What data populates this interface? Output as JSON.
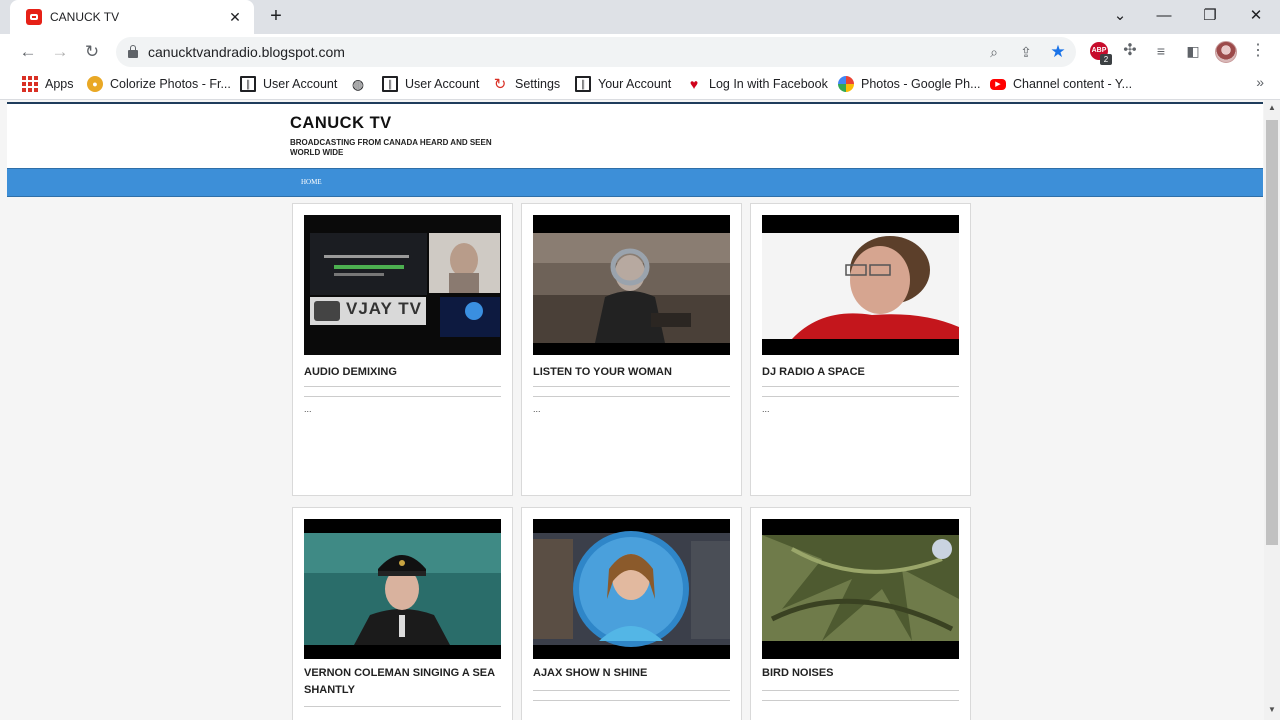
{
  "browser": {
    "tab_title": "CANUCK TV",
    "url": "canucktvandradio.blogspot.com",
    "abp_badge": "2",
    "bookmarks": [
      {
        "label": "Apps",
        "icon": "apps-grid-icon"
      },
      {
        "label": "Colorize Photos - Fr...",
        "icon": "colorize-icon"
      },
      {
        "label": "User Account",
        "icon": "building-icon"
      },
      {
        "label": "",
        "icon": "globe-icon"
      },
      {
        "label": "User Account",
        "icon": "building-icon"
      },
      {
        "label": "Settings",
        "icon": "settings-swirl-icon"
      },
      {
        "label": "Your Account",
        "icon": "building-icon"
      },
      {
        "label": "Log In with Facebook",
        "icon": "heart-icon"
      },
      {
        "label": "Photos - Google Ph...",
        "icon": "pinwheel-icon"
      },
      {
        "label": "Channel content - Y...",
        "icon": "youtube-icon"
      }
    ]
  },
  "blog": {
    "title": "CANUCK TV",
    "description": "BROADCASTING FROM CANADA HEARD AND SEEN WORLD WIDE",
    "nav_home": "HOME",
    "accent_color": "#3d8fd8"
  },
  "posts": [
    {
      "title": "AUDIO DEMIXING",
      "snippet": "...",
      "thumb_text": "VJAY TV"
    },
    {
      "title": "LISTEN TO YOUR WOMAN",
      "snippet": "..."
    },
    {
      "title": "DJ RADIO A SPACE",
      "snippet": "..."
    },
    {
      "title": "VERNON COLEMAN SINGING A SEA SHANTLY",
      "snippet": ""
    },
    {
      "title": "AJAX SHOW N SHINE",
      "snippet": ""
    },
    {
      "title": "BIRD NOISES",
      "snippet": ""
    }
  ]
}
